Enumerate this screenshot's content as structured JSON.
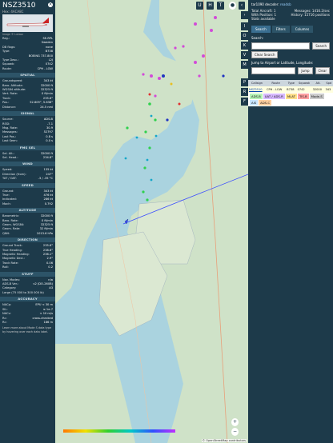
{
  "flight": {
    "callsign": "NSZ3510",
    "hex_line": "Hex: 4ACA8C",
    "image_credit": "Image © Lukasz"
  },
  "info": [
    {
      "k": "Reg.:",
      "v": "SE-RPL"
    },
    {
      "k": "",
      "v": "Sweden"
    },
    {
      "k": "DB flags:",
      "v": "none"
    },
    {
      "k": "Type:",
      "v": "B738"
    },
    {
      "k": "",
      "v": "BOEING 737-800"
    },
    {
      "k": "Type Desc.:",
      "v": "L2J"
    },
    {
      "k": "Squawk:",
      "v": "0742"
    },
    {
      "k": "Route:",
      "v": "CPH - LGW"
    }
  ],
  "sections": {
    "spatial": "SPATIAL",
    "signal": "SIGNAL",
    "fms": "FMS SEL",
    "wind": "WIND",
    "speed": "SPEED",
    "altitude": "ALTITUDE",
    "direction": "DIRECTION",
    "stuff": "STUFF",
    "accuracy": "ACCURACY"
  },
  "spatial": [
    {
      "k": "Groundspeed:",
      "v": "343 kt"
    },
    {
      "k": "Baro. Altitude:",
      "v": "32000 ft"
    },
    {
      "k": "WGS84 altitude:",
      "v": "32325 ft"
    },
    {
      "k": "Vert. Rate:",
      "v": "0 ft/min"
    },
    {
      "k": "Track:",
      "v": "235.6°"
    },
    {
      "k": "Pos.:",
      "v": "52.609°, 5.638°"
    },
    {
      "k": "Distance:",
      "v": "24.5 nmi"
    }
  ],
  "signal": [
    {
      "k": "Source:",
      "v": "ADS-B"
    },
    {
      "k": "RSSI:",
      "v": "-7.1"
    },
    {
      "k": "Msg. Rate:",
      "v": "30.9"
    },
    {
      "k": "Messages:",
      "v": "52797"
    },
    {
      "k": "Last Pos.:",
      "v": "0.8 s"
    },
    {
      "k": "Last Seen:",
      "v": "0.0 s"
    }
  ],
  "fms": [
    {
      "k": "Sel. Alt.:",
      "v": "32000 ft"
    },
    {
      "k": "Sel. Head.:",
      "v": "234.8°"
    }
  ],
  "wind": [
    {
      "k": "Speed:",
      "v": "135 kt"
    },
    {
      "k": "Direction (from):",
      "v": "247°"
    },
    {
      "k": "TAT / OAT:",
      "v": "-3 / -35 °C"
    }
  ],
  "speed": [
    {
      "k": "Ground:",
      "v": "343 kt"
    },
    {
      "k": "True:",
      "v": "476 kt"
    },
    {
      "k": "Indicated:",
      "v": "286 kt"
    },
    {
      "k": "Mach:",
      "v": "0.792"
    }
  ],
  "altitude": [
    {
      "k": "Barometric:",
      "v": "32000 ft"
    },
    {
      "k": "Baro. Rate:",
      "v": "0 ft/min"
    },
    {
      "k": "Geom. WGS84:",
      "v": "32325 ft"
    },
    {
      "k": "Geom. Rate:",
      "v": "32 ft/min"
    },
    {
      "k": "QNH:",
      "v": "1013.6 hPa"
    }
  ],
  "direction": [
    {
      "k": "Ground Track:",
      "v": "235.6°"
    },
    {
      "k": "True Heading:",
      "v": "238.6°"
    },
    {
      "k": "Magnetic Heading:",
      "v": "236.1°"
    },
    {
      "k": "Magnetic Decl.:",
      "v": "2.9°"
    },
    {
      "k": "Track Rate:",
      "v": "0.06"
    },
    {
      "k": "Roll:",
      "v": "0.2"
    }
  ],
  "stuff": [
    {
      "k": "Nav. Modes:",
      "v": "n/a"
    },
    {
      "k": "ADS-B Ver.:",
      "v": "v2 (DO-260B)"
    },
    {
      "k": "Category:",
      "v": "A3"
    },
    {
      "k": "Large (75 000 to 300 000 lb)",
      "v": ""
    }
  ],
  "accuracy": [
    {
      "k": "NACp:",
      "v": "EPU < 30 m"
    },
    {
      "k": "SIL:",
      "v": "≤ 1e-7"
    },
    {
      "k": "NACv:",
      "v": "< 10 m/s"
    },
    {
      "k": "Rc:",
      "v": "cross-checked"
    },
    {
      "k": "Rc:",
      "v": "186 m"
    }
  ],
  "bottom_note": "Learn more about Mode S data type by hovering over each data label.",
  "map": {
    "top_buttons": [
      "U",
      "H",
      "T"
    ],
    "side_buttons": [
      "I",
      "O",
      "K",
      "V",
      "M",
      "P",
      "R",
      "F"
    ],
    "zoom_in": "+",
    "zoom_out": "−",
    "attribution": "© OpenStreetMap contributors"
  },
  "right": {
    "brand": "tar1090",
    "decoder_text": "decoder:",
    "decoder_link": "readsb",
    "stats": [
      {
        "k": "Total Aircraft: 1",
        "v": "Messages: 1416.2/sec"
      },
      {
        "k": "With Position: 1",
        "v": "History: 15716 positions"
      }
    ],
    "stats_available": "Stats available",
    "tabs": [
      "Search",
      "Filters",
      "Columns"
    ],
    "search_label": "Search:",
    "search_btn": "Search",
    "clear_btn": "Clear Search",
    "jump_label": "Jump to Airport or Latitude, Longitude:",
    "jump_btn": "Jump",
    "jump_clear": "Clear",
    "table_headers": [
      "Callsign",
      "Route",
      "Type",
      "Squawk",
      "Alt.",
      "Spd"
    ],
    "table_row": [
      "NSZ3510",
      "CPH - LGW",
      "B738",
      "0742",
      "32000",
      "343"
    ],
    "legend": [
      "ADS-B",
      "UAT / ADS-R",
      "MLAT",
      "TIS-B",
      "Mode-S",
      "AIS",
      "ADS-C"
    ],
    "legend_colors": [
      "#b6f2b6",
      "#d7b9ff",
      "#ffe08a",
      "#ffa0a0",
      "#cccccc",
      "#c7e6ff",
      "#ffd0a0"
    ]
  },
  "colors": {
    "panel": "#1d3a4a",
    "water": "#aad3df",
    "land": "#cfe2c8"
  }
}
